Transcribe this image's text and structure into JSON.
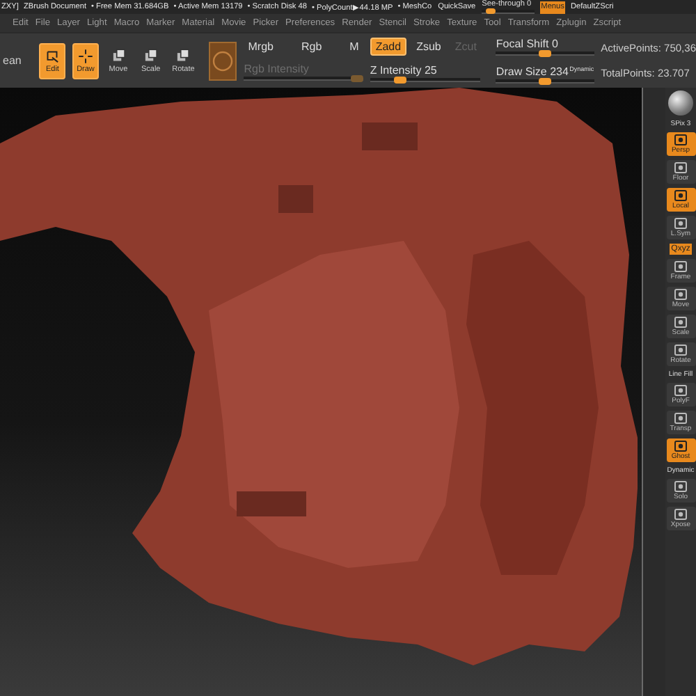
{
  "title_bar": {
    "items": [
      {
        "kind": "text",
        "label": "ZXY]"
      },
      {
        "kind": "text",
        "label": "ZBrush Document"
      },
      {
        "kind": "text",
        "label": "• Free Mem 31.684GB"
      },
      {
        "kind": "text",
        "label": "• Active Mem 13179"
      },
      {
        "kind": "text",
        "label": "• Scratch Disk 48"
      },
      {
        "kind": "text",
        "label": "• PolyCount▶44.18 MP"
      },
      {
        "kind": "text",
        "label": "• MeshCo"
      },
      {
        "kind": "button",
        "label": "QuickSave",
        "selected": false
      },
      {
        "kind": "slider",
        "label": "See-through 0",
        "level": 0.1
      },
      {
        "kind": "button",
        "label": "Menus",
        "selected": true
      },
      {
        "kind": "text",
        "label": "DefaultZScri"
      }
    ]
  },
  "menu_bar": [
    "Edit",
    "File",
    "Layer",
    "Light",
    "Macro",
    "Marker",
    "Material",
    "Movie",
    "Picker",
    "Preferences",
    "Render",
    "Stencil",
    "Stroke",
    "Texture",
    "Tool",
    "Transform",
    "Zplugin",
    "Zscript"
  ],
  "toolbar": {
    "cut_label": "ean",
    "modes": [
      {
        "label": "Edit",
        "selected": true
      },
      {
        "label": "Draw",
        "selected": true
      },
      {
        "label": "Move",
        "selected": false
      },
      {
        "label": "Scale",
        "selected": false
      },
      {
        "label": "Rotate",
        "selected": false
      }
    ],
    "color_modes": [
      {
        "label": "Mrgb",
        "selected": false
      },
      {
        "label": "Rgb",
        "selected": false
      },
      {
        "label": "M",
        "selected": false
      }
    ],
    "rgb_intensity": {
      "label": "Rgb Intensity",
      "disabled": true,
      "level": 1
    },
    "depth_modes": [
      {
        "label": "Zadd",
        "selected": true,
        "disabled": false
      },
      {
        "label": "Zsub",
        "selected": false,
        "disabled": false
      },
      {
        "label": "Zcut",
        "selected": false,
        "disabled": true
      }
    ],
    "z_intensity": {
      "label": "Z Intensity 25",
      "level": 0.25
    },
    "focal_shift": {
      "label": "Focal Shift 0",
      "level": 0.5
    },
    "draw_size": {
      "label": "Draw Size 234",
      "level": 0.5,
      "badge": "Dynamic"
    },
    "stats": [
      "ActivePoints: 750,36",
      "TotalPoints: 23.707"
    ]
  },
  "right_tray": [
    {
      "kind": "sphere"
    },
    {
      "kind": "label",
      "label": "SPix 3",
      "selected": false
    },
    {
      "kind": "button",
      "label": "Persp",
      "selected": true
    },
    {
      "kind": "button",
      "label": "Floor",
      "selected": false
    },
    {
      "kind": "button",
      "label": "Local",
      "selected": true
    },
    {
      "kind": "button",
      "label": "L.Sym",
      "selected": false
    },
    {
      "kind": "small",
      "label": "Qxyz",
      "selected": true
    },
    {
      "kind": "button",
      "label": "Frame",
      "selected": false
    },
    {
      "kind": "button",
      "label": "Move",
      "selected": false
    },
    {
      "kind": "button",
      "label": "Scale",
      "selected": false
    },
    {
      "kind": "button",
      "label": "Rotate",
      "selected": false
    },
    {
      "kind": "label",
      "label": "Line Fill",
      "selected": false
    },
    {
      "kind": "button",
      "label": "PolyF",
      "selected": false
    },
    {
      "kind": "button",
      "label": "Transp",
      "selected": false
    },
    {
      "kind": "button",
      "label": "Ghost",
      "selected": true
    },
    {
      "kind": "label",
      "label": "Dynamic",
      "selected": false
    },
    {
      "kind": "button",
      "label": "Solo",
      "selected": false
    },
    {
      "kind": "button",
      "label": "Xpose",
      "selected": false
    }
  ]
}
